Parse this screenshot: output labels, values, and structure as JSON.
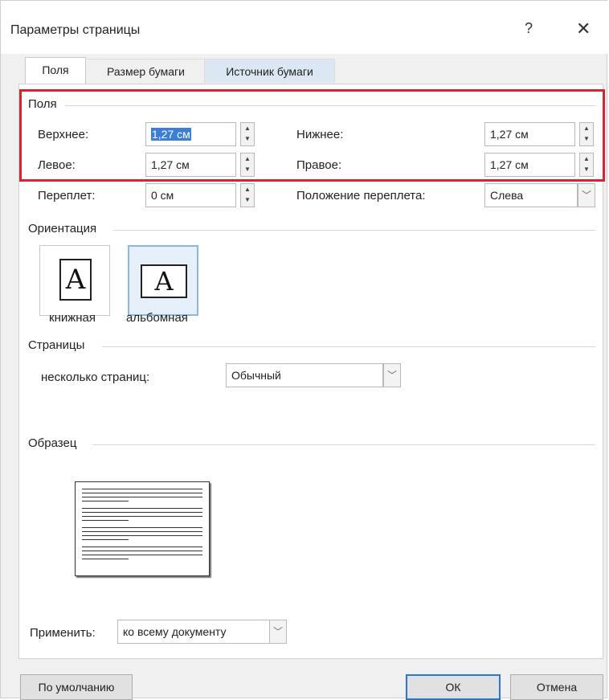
{
  "window": {
    "title": "Параметры страницы",
    "help_icon": "?",
    "close_icon": "✕"
  },
  "tabs": [
    {
      "label": "Поля",
      "active": true
    },
    {
      "label": "Размер бумаги",
      "active": false
    },
    {
      "label": "Источник бумаги",
      "active": false
    }
  ],
  "margins": {
    "section": "Поля",
    "top": {
      "label": "Верхнее:",
      "value": "1,27 см"
    },
    "bottom": {
      "label": "Нижнее:",
      "value": "1,27 см"
    },
    "left": {
      "label": "Левое:",
      "value": "1,27 см"
    },
    "right": {
      "label": "Правое:",
      "value": "1,27 см"
    },
    "gutter": {
      "label": "Переплет:",
      "value": "0 см"
    },
    "gutter_pos": {
      "label": "Положение переплета:",
      "value": "Слева"
    }
  },
  "orientation": {
    "section": "Ориентация",
    "portrait": {
      "label": "книжная",
      "glyph": "A"
    },
    "landscape": {
      "label": "альбомная",
      "glyph": "A"
    },
    "selected": "landscape"
  },
  "pages": {
    "section": "Страницы",
    "label": "несколько страниц:",
    "value": "Обычный"
  },
  "sample": {
    "section": "Образец"
  },
  "apply": {
    "label": "Применить:",
    "value": "ко всему документу"
  },
  "buttons": {
    "default": "По умолчанию",
    "ok": "ОК",
    "cancel": "Отмена"
  },
  "colors": {
    "highlight_box": "#d32630",
    "selection": "#3a7fd5"
  },
  "icons": {
    "spin": "spinner-arrows-icon",
    "dropdown": "chevron-down-icon"
  }
}
